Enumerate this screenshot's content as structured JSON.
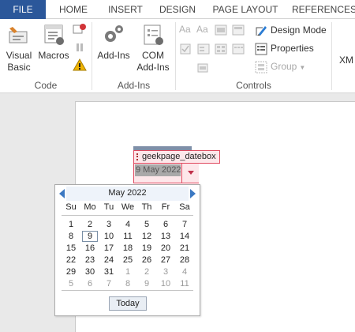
{
  "tabs": [
    "FILE",
    "HOME",
    "INSERT",
    "DESIGN",
    "PAGE LAYOUT",
    "REFERENCES"
  ],
  "ribbon": {
    "code_group": {
      "label": "Code",
      "visual_basic": "Visual\nBasic",
      "visual_basic_line1": "Visual",
      "visual_basic_line2": "Basic",
      "macros": "Macros"
    },
    "addins_group": {
      "label": "Add-Ins",
      "addins": "Add-Ins",
      "com_line1": "COM",
      "com_line2": "Add-Ins"
    },
    "controls_group": {
      "label": "Controls",
      "design_mode": "Design Mode",
      "properties": "Properties",
      "group": "Group"
    },
    "xml_partial": "XM"
  },
  "content_control": {
    "tag": "geekpage_datebox",
    "value": "9 May 2022"
  },
  "calendar": {
    "month_title": "May 2022",
    "weekdays": [
      "Su",
      "Mo",
      "Tu",
      "We",
      "Th",
      "Fr",
      "Sa"
    ],
    "weeks": [
      [
        {
          "d": "1"
        },
        {
          "d": "2"
        },
        {
          "d": "3"
        },
        {
          "d": "4"
        },
        {
          "d": "5"
        },
        {
          "d": "6"
        },
        {
          "d": "7"
        }
      ],
      [
        {
          "d": "8"
        },
        {
          "d": "9",
          "today": true
        },
        {
          "d": "10"
        },
        {
          "d": "11"
        },
        {
          "d": "12"
        },
        {
          "d": "13"
        },
        {
          "d": "14"
        }
      ],
      [
        {
          "d": "15"
        },
        {
          "d": "16"
        },
        {
          "d": "17"
        },
        {
          "d": "18"
        },
        {
          "d": "19"
        },
        {
          "d": "20"
        },
        {
          "d": "21"
        }
      ],
      [
        {
          "d": "22"
        },
        {
          "d": "23"
        },
        {
          "d": "24"
        },
        {
          "d": "25"
        },
        {
          "d": "26"
        },
        {
          "d": "27"
        },
        {
          "d": "28"
        }
      ],
      [
        {
          "d": "29"
        },
        {
          "d": "30"
        },
        {
          "d": "31"
        },
        {
          "d": "1",
          "other": true
        },
        {
          "d": "2",
          "other": true
        },
        {
          "d": "3",
          "other": true
        },
        {
          "d": "4",
          "other": true
        }
      ],
      [
        {
          "d": "5",
          "other": true
        },
        {
          "d": "6",
          "other": true
        },
        {
          "d": "7",
          "other": true
        },
        {
          "d": "8",
          "other": true
        },
        {
          "d": "9",
          "other": true
        },
        {
          "d": "10",
          "other": true
        },
        {
          "d": "11",
          "other": true
        }
      ]
    ],
    "today_button": "Today"
  },
  "colors": {
    "file_tab": "#2b579a",
    "control_border": "#e04a60",
    "control_fill": "#fde7ea",
    "nav_arrow": "#3b78c2"
  },
  "icons": [
    "visual-basic-icon",
    "macros-icon",
    "record-macro-icon",
    "pause-icon",
    "macro-security-icon",
    "addins-icon",
    "com-addins-icon",
    "design-mode-icon",
    "properties-icon",
    "group-icon"
  ]
}
